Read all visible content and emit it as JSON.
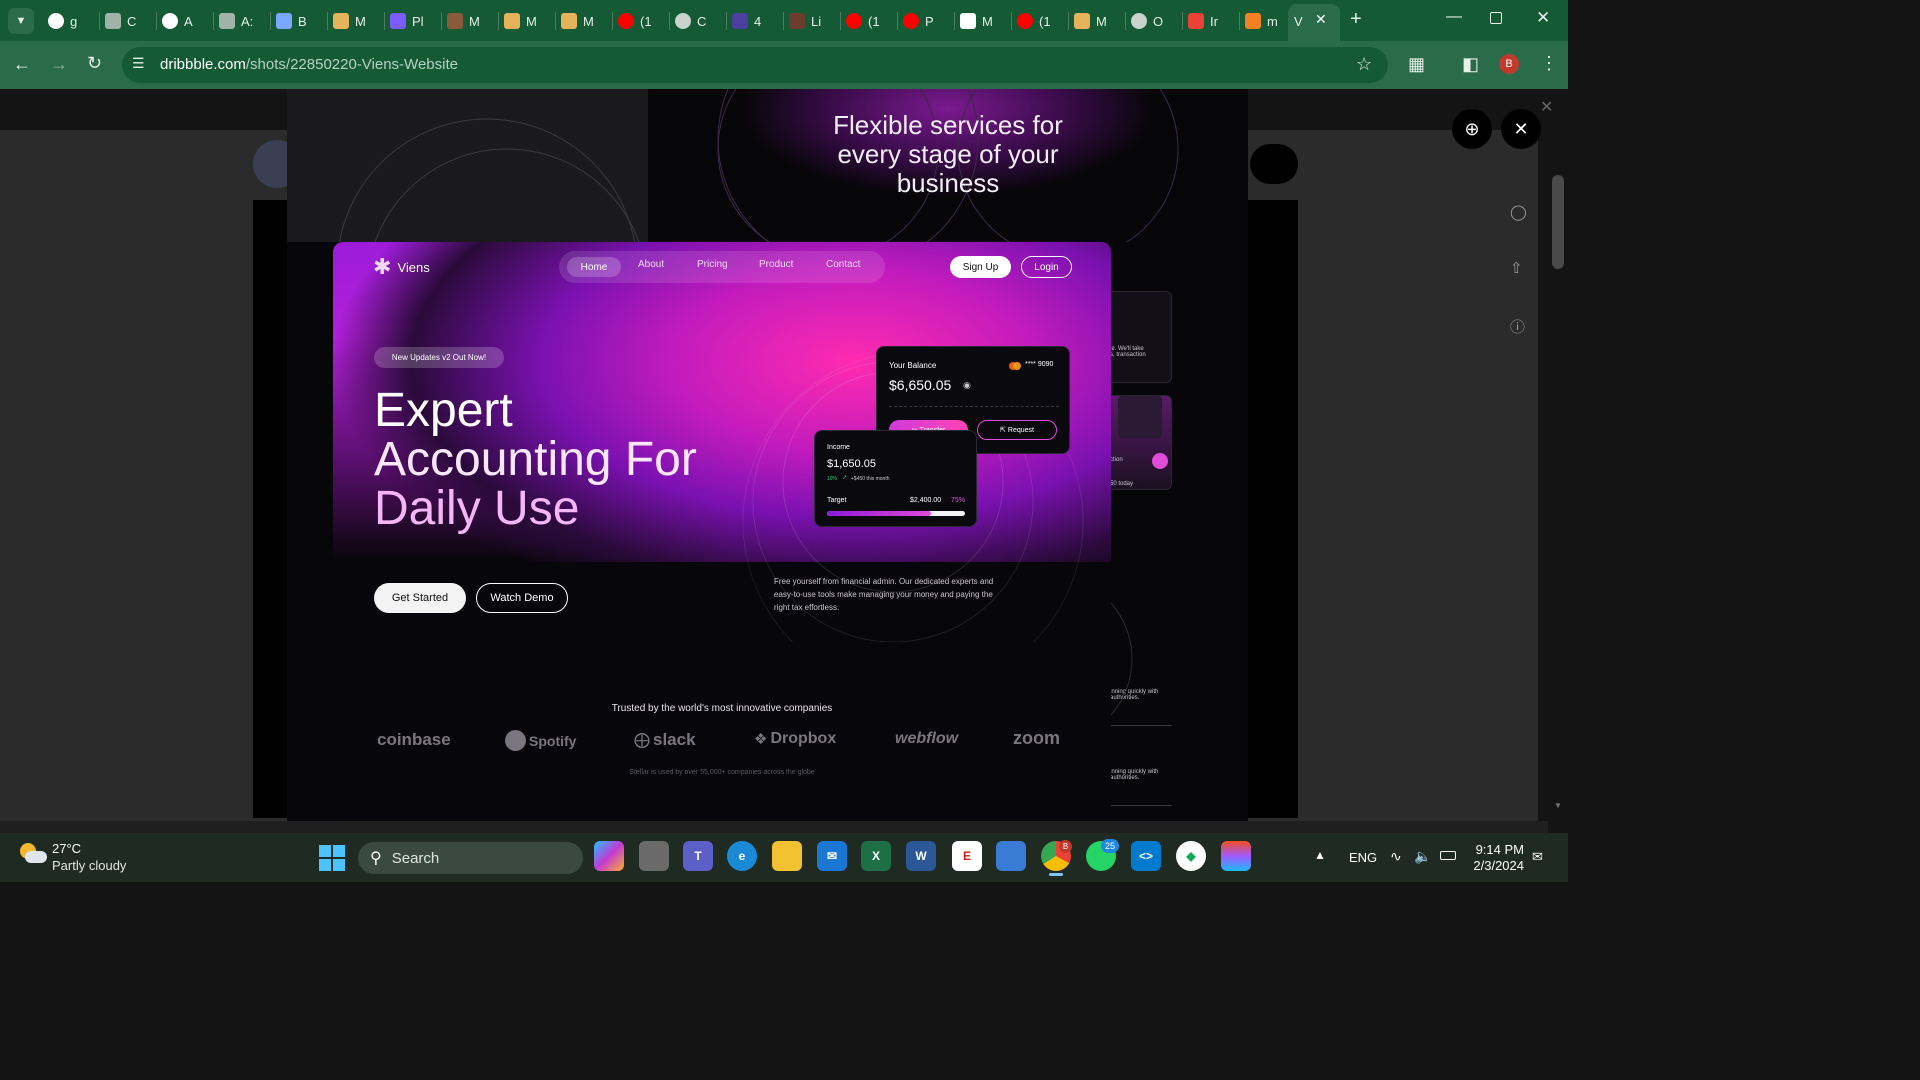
{
  "browser": {
    "tabs": [
      {
        "label": "g",
        "icon": "google-icon",
        "color": "#ffffff"
      },
      {
        "label": "C",
        "icon": "chatgpt-icon",
        "color": "#9fb3a7"
      },
      {
        "label": "A",
        "icon": "google-icon",
        "color": "#ffffff"
      },
      {
        "label": "A:",
        "icon": "chatgpt-icon",
        "color": "#9fb3a7"
      },
      {
        "label": "B",
        "icon": "gemini-icon",
        "color": "#7aa7ff"
      },
      {
        "label": "M",
        "icon": "gmail-icon",
        "color": "#e6b35a"
      },
      {
        "label": "Pl",
        "icon": "arc-icon",
        "color": "#7b5cff"
      },
      {
        "label": "M",
        "icon": "book-icon",
        "color": "#8a5a3a"
      },
      {
        "label": "M",
        "icon": "gmail-icon",
        "color": "#e6b35a"
      },
      {
        "label": "M",
        "icon": "gmail-icon",
        "color": "#e6b35a"
      },
      {
        "label": "(1",
        "icon": "youtube-icon",
        "color": "#ff0000"
      },
      {
        "label": "C",
        "icon": "globe-icon",
        "color": "#c9d3cc"
      },
      {
        "label": "4",
        "icon": "coloro-icon",
        "color": "#4b3fa0"
      },
      {
        "label": "Li",
        "icon": "star-icon",
        "color": "#6b3b2b"
      },
      {
        "label": "(1",
        "icon": "youtube-icon",
        "color": "#ff0000"
      },
      {
        "label": "P",
        "icon": "youtube-icon",
        "color": "#ff0000"
      },
      {
        "label": "M",
        "icon": "m-icon",
        "color": "#ffffff"
      },
      {
        "label": "(1",
        "icon": "youtube-icon",
        "color": "#ff0000"
      },
      {
        "label": "M",
        "icon": "gmail-icon",
        "color": "#e6b35a"
      },
      {
        "label": "O",
        "icon": "globe-icon",
        "color": "#c9d3cc"
      },
      {
        "label": "Ir",
        "icon": "gmail-color-icon",
        "color": "#ea4335"
      },
      {
        "label": "m",
        "icon": "stack-icon",
        "color": "#f48024"
      },
      {
        "label": "V",
        "icon": "dribbble-icon",
        "color": "#2a6b49"
      }
    ],
    "url_domain": "dribbble.com",
    "url_path": "/shots/22850220-Viens-Website",
    "profile_initial": "B"
  },
  "modal": {
    "top_heading": "Flexible services for every stage of your business",
    "side_text_1": "ie. We'll take\ns, transaction",
    "side_text_2": "ction",
    "side_text_3": "50 today",
    "side_text_4": "inning quickly with\nauthorities.",
    "side_text_5": "inning quickly with\nauthorities."
  },
  "hero": {
    "brand": "Viens",
    "nav": [
      "Home",
      "About",
      "Pricing",
      "Product",
      "Contact"
    ],
    "signup": "Sign Up",
    "login": "Login",
    "badge": "New Updates v2 Out Now!",
    "headline_1": "Expert",
    "headline_2": "Accounting For",
    "headline_3": "Daily Use",
    "get_started": "Get Started",
    "watch_demo": "Watch Demo",
    "description": "Free yourself from financial admin. Our dedicated experts and easy-to-use tools make managing your money and paying the right tax effortless.",
    "trusted": "Trusted by the world's most innovative companies",
    "logos": [
      "coinbase",
      "Spotify",
      "slack",
      "Dropbox",
      "webflow",
      "zoom"
    ],
    "usage_note": "Stellar is used by over 55,000+ companies across the globe"
  },
  "balance_card": {
    "label": "Your Balance",
    "card_digits": "**** 9090",
    "amount": "$6,650.05",
    "transfer": "Transfer",
    "request": "Request"
  },
  "income_card": {
    "label": "Income",
    "amount": "$1,650.05",
    "change_pct": "10%",
    "change_text": "+$450 this month",
    "target_label": "Target",
    "target_amount": "$2,400.00",
    "target_pct": "75%",
    "progress": 0.75
  },
  "taskbar": {
    "weather_temp": "27°C",
    "weather_desc": "Partly cloudy",
    "search": "Search",
    "lang": "ENG",
    "time": "9:14 PM",
    "date": "2/3/2024",
    "chrome_badge": "B",
    "whatsapp_badge": "25"
  }
}
